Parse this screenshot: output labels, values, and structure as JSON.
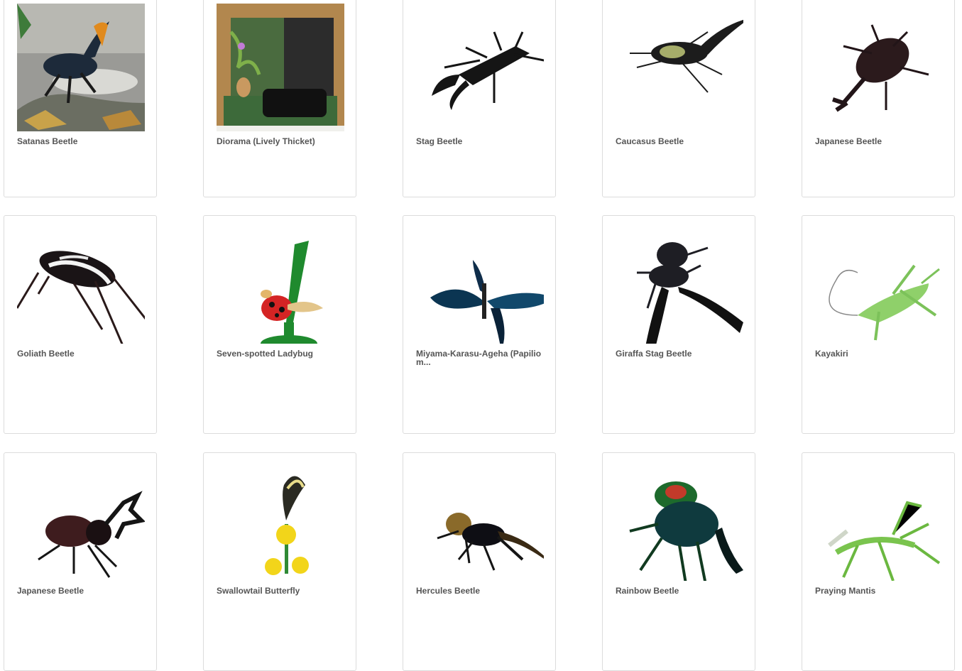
{
  "products": [
    {
      "title": "Satanas Beetle",
      "icon": "satanas-beetle-photo"
    },
    {
      "title": "Diorama (Lively Thicket)",
      "icon": "diorama-photo"
    },
    {
      "title": "Stag Beetle",
      "icon": "stag-beetle-image"
    },
    {
      "title": "Caucasus Beetle",
      "icon": "caucasus-beetle-image"
    },
    {
      "title": "Japanese Beetle",
      "icon": "japanese-beetle-image"
    },
    {
      "title": "Goliath Beetle",
      "icon": "goliath-beetle-image"
    },
    {
      "title": "Seven-spotted Ladybug",
      "icon": "ladybug-image"
    },
    {
      "title": "Miyama-Karasu-Ageha (Papilio m...",
      "icon": "butterfly-image"
    },
    {
      "title": "Giraffa Stag Beetle",
      "icon": "giraffa-stag-beetle-image"
    },
    {
      "title": "Kayakiri",
      "icon": "katydid-image"
    },
    {
      "title": "Japanese Beetle",
      "icon": "japanese-beetle-image"
    },
    {
      "title": "Swallowtail Butterfly",
      "icon": "swallowtail-image"
    },
    {
      "title": "Hercules Beetle",
      "icon": "hercules-beetle-image"
    },
    {
      "title": "Rainbow Beetle",
      "icon": "rainbow-beetle-image"
    },
    {
      "title": "Praying Mantis",
      "icon": "mantis-image"
    }
  ]
}
